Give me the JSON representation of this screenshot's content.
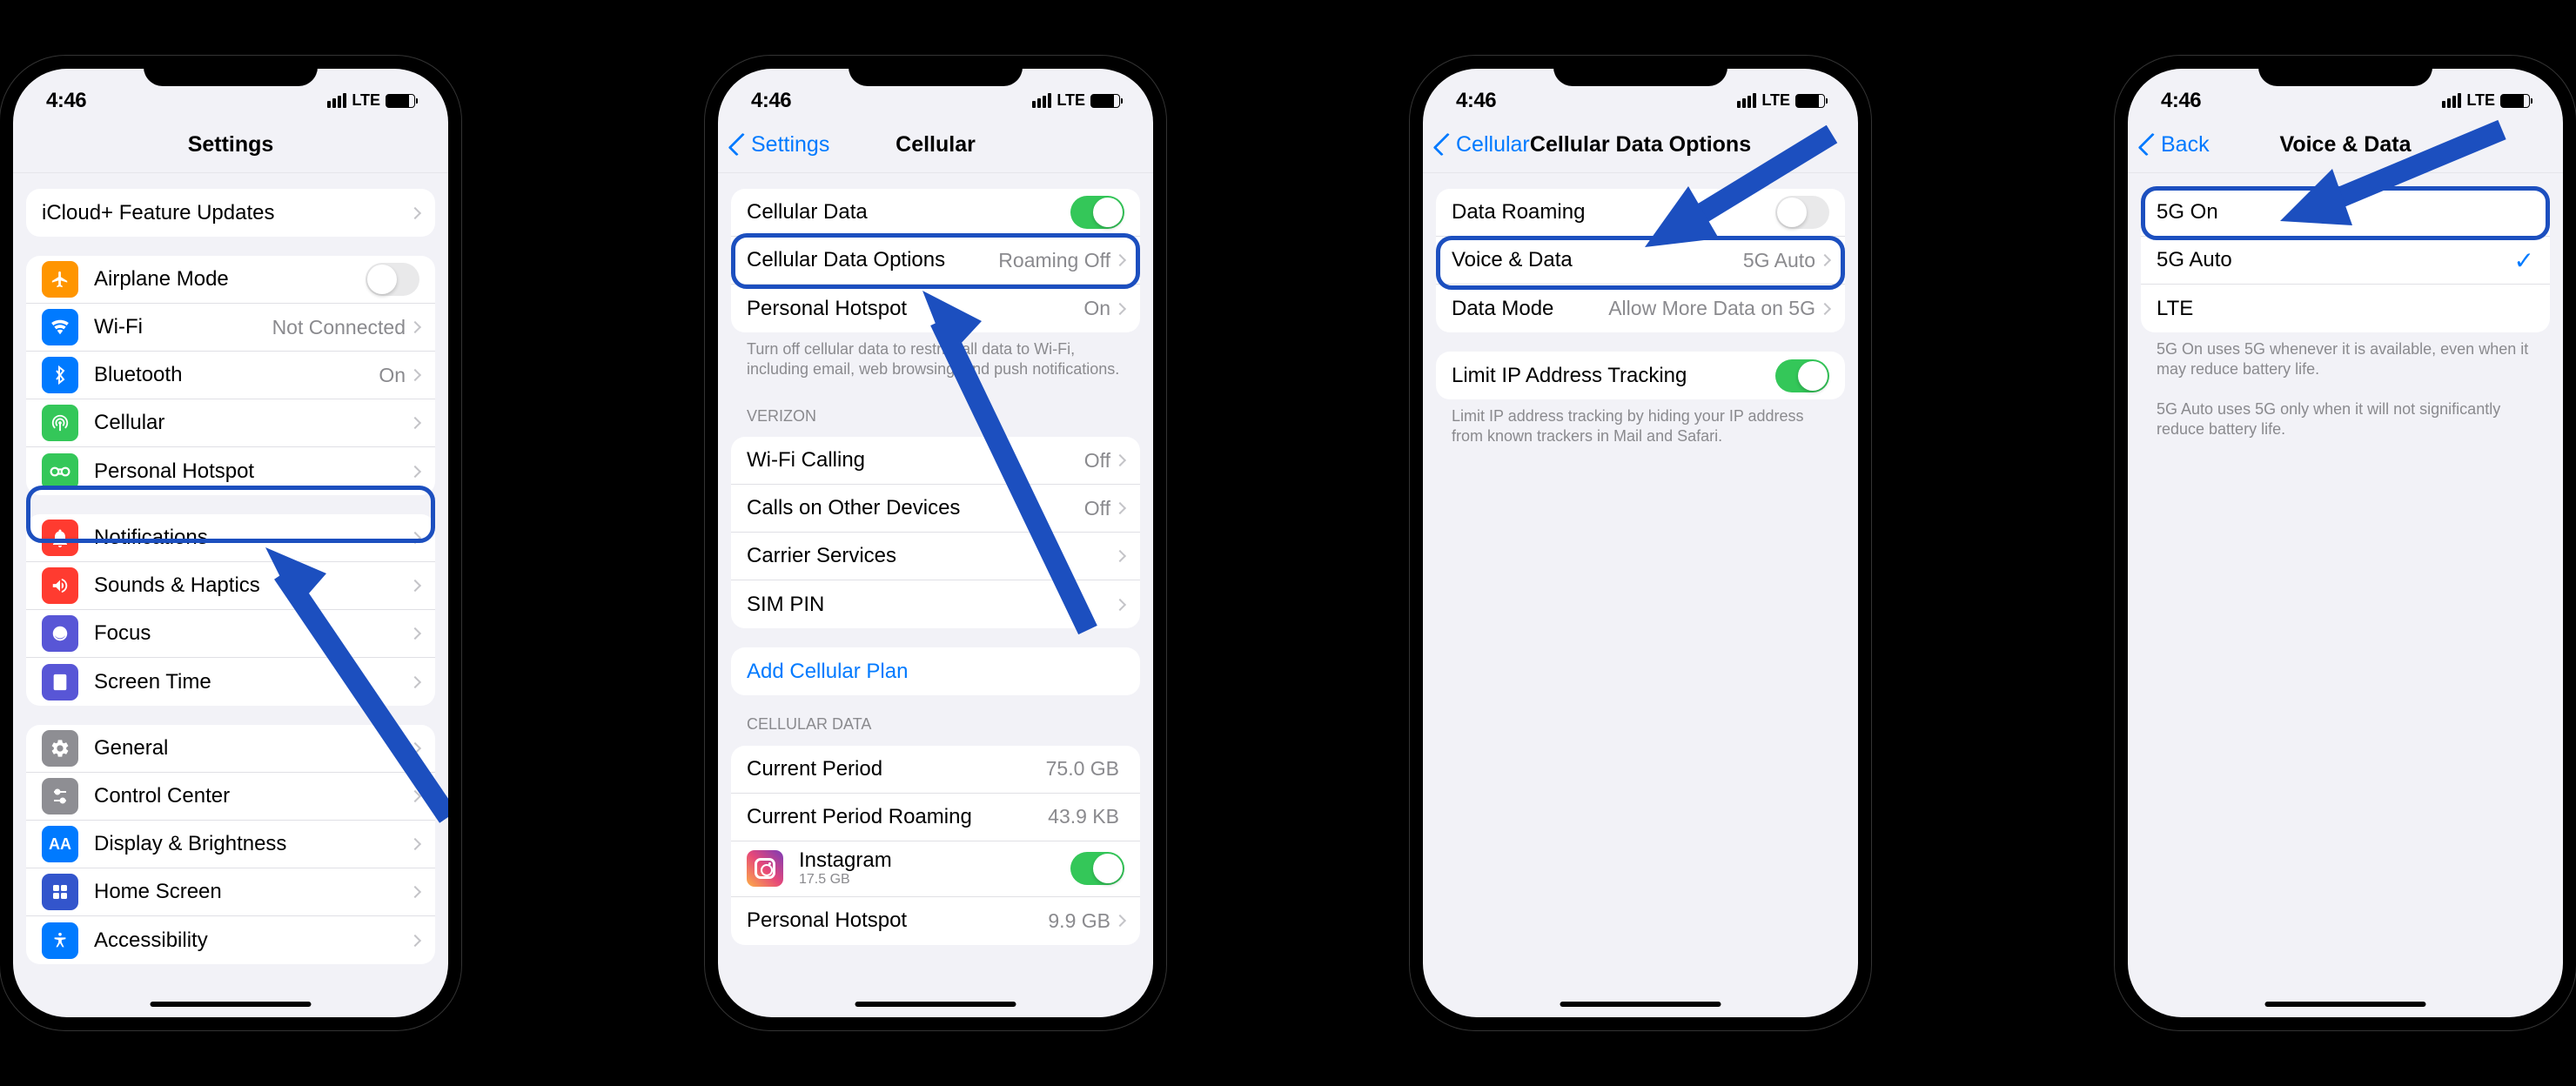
{
  "status": {
    "time": "4:46",
    "network": "LTE"
  },
  "colors": {
    "highlight": "#1c4fbf",
    "link": "#007aff",
    "toggle_on": "#34c759"
  },
  "screen1": {
    "title": "Settings",
    "group1": [
      {
        "label": "iCloud+ Feature Updates"
      }
    ],
    "group2": [
      {
        "icon": "airplane",
        "bg": "#ff9500",
        "label": "Airplane Mode",
        "toggle": false
      },
      {
        "icon": "wifi",
        "bg": "#007aff",
        "label": "Wi-Fi",
        "value": "Not Connected"
      },
      {
        "icon": "bluetooth",
        "bg": "#007aff",
        "label": "Bluetooth",
        "value": "On"
      },
      {
        "icon": "cellular",
        "bg": "#34c759",
        "label": "Cellular"
      },
      {
        "icon": "hotspot",
        "bg": "#34c759",
        "label": "Personal Hotspot"
      }
    ],
    "group3": [
      {
        "icon": "notifications",
        "bg": "#ff3b30",
        "label": "Notifications"
      },
      {
        "icon": "sounds",
        "bg": "#ff3b30",
        "label": "Sounds & Haptics"
      },
      {
        "icon": "focus",
        "bg": "#5856d6",
        "label": "Focus"
      },
      {
        "icon": "screentime",
        "bg": "#5856d6",
        "label": "Screen Time"
      }
    ],
    "group4": [
      {
        "icon": "general",
        "bg": "#8e8e93",
        "label": "General"
      },
      {
        "icon": "controlcenter",
        "bg": "#8e8e93",
        "label": "Control Center"
      },
      {
        "icon": "display",
        "bg": "#007aff",
        "label": "Display & Brightness"
      },
      {
        "icon": "homescreen",
        "bg": "#3355cc",
        "label": "Home Screen"
      },
      {
        "icon": "accessibility",
        "bg": "#007aff",
        "label": "Accessibility"
      }
    ]
  },
  "screen2": {
    "back": "Settings",
    "title": "Cellular",
    "group1": {
      "rows": [
        {
          "label": "Cellular Data",
          "toggle": true
        },
        {
          "label": "Cellular Data Options",
          "value": "Roaming Off"
        },
        {
          "label": "Personal Hotspot",
          "value": "On"
        }
      ],
      "footer": "Turn off cellular data to restrict all data to Wi-Fi, including email, web browsing, and push notifications."
    },
    "group2": {
      "header": "VERIZON",
      "rows": [
        {
          "label": "Wi-Fi Calling",
          "value": "Off"
        },
        {
          "label": "Calls on Other Devices",
          "value": "Off"
        },
        {
          "label": "Carrier Services"
        },
        {
          "label": "SIM PIN"
        }
      ]
    },
    "group3": {
      "rows": [
        {
          "label": "Add Cellular Plan",
          "link": true
        }
      ]
    },
    "group4": {
      "header": "CELLULAR DATA",
      "rows": [
        {
          "label": "Current Period",
          "value": "75.0 GB"
        },
        {
          "label": "Current Period Roaming",
          "value": "43.9 KB"
        },
        {
          "label": "Instagram",
          "sub": "17.5 GB",
          "icon": "instagram",
          "toggle": true
        },
        {
          "label": "Personal Hotspot",
          "value": "9.9 GB"
        }
      ]
    }
  },
  "screen3": {
    "back": "Cellular",
    "title": "Cellular Data Options",
    "group1": {
      "rows": [
        {
          "label": "Data Roaming",
          "toggle": false
        },
        {
          "label": "Voice & Data",
          "value": "5G Auto"
        },
        {
          "label": "Data Mode",
          "value": "Allow More Data on 5G"
        }
      ]
    },
    "group2": {
      "rows": [
        {
          "label": "Limit IP Address Tracking",
          "toggle": true
        }
      ],
      "footer": "Limit IP address tracking by hiding your IP address from known trackers in Mail and Safari."
    }
  },
  "screen4": {
    "back": "Back",
    "title": "Voice & Data",
    "group1": {
      "rows": [
        {
          "label": "5G On"
        },
        {
          "label": "5G Auto",
          "checked": true
        },
        {
          "label": "LTE"
        }
      ]
    },
    "footer1": "5G On uses 5G whenever it is available, even when it may reduce battery life.",
    "footer2": "5G Auto uses 5G only when it will not significantly reduce battery life."
  }
}
